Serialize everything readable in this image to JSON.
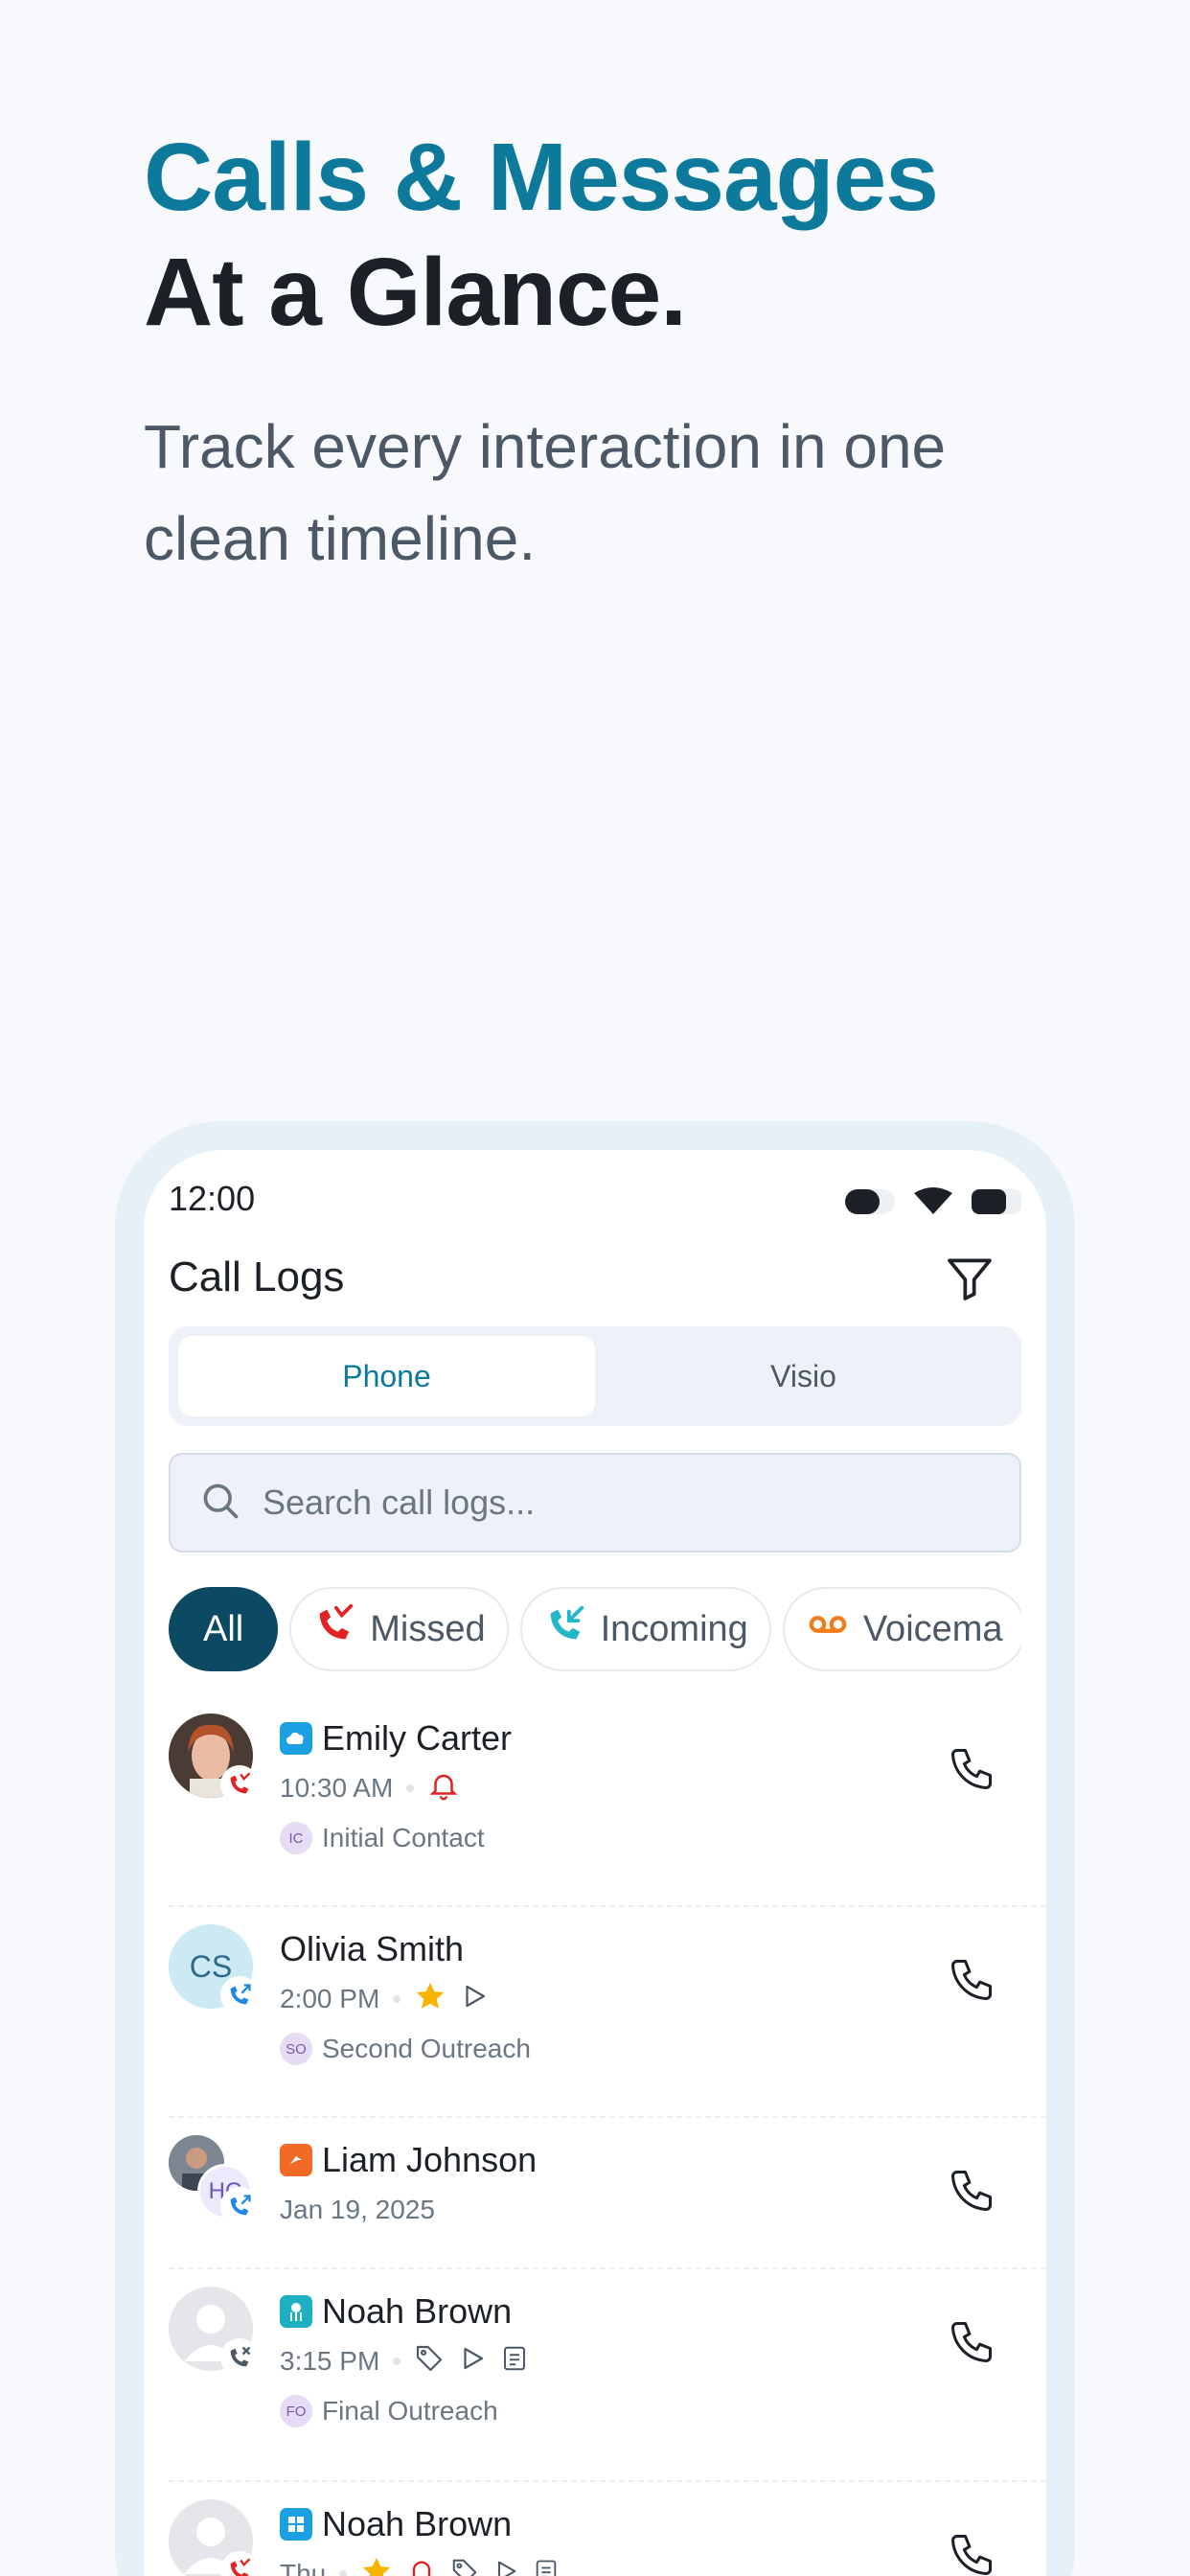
{
  "hero": {
    "title_line1": "Calls & Messages",
    "title_line2": "At a Glance.",
    "subtitle": "Track every interaction in one clean timeline."
  },
  "status_bar": {
    "time": "12:00"
  },
  "header": {
    "title": "Call Logs",
    "filter_icon": "filter-icon"
  },
  "tabs": [
    {
      "label": "Phone",
      "active": true
    },
    {
      "label": "Visio",
      "active": false
    }
  ],
  "search": {
    "placeholder": "Search call logs..."
  },
  "chips": [
    {
      "label": "All",
      "active": true
    },
    {
      "label": "Missed",
      "icon": "missed-call-icon",
      "color": "#e02424"
    },
    {
      "label": "Incoming",
      "icon": "incoming-call-icon",
      "color": "#22b8c9"
    },
    {
      "label": "Voicema",
      "icon": "voicemail-icon",
      "color": "#f07c1a"
    }
  ],
  "calls": [
    {
      "name": "Emily Carter",
      "time": "10:30 AM",
      "tag_initials": "IC",
      "tag": "Initial Contact",
      "brand_color": "#1ba0e2",
      "status": "missed",
      "extras": [
        "bell-icon"
      ]
    },
    {
      "name": "Olivia Smith",
      "avatar_initials": "CS",
      "time": "2:00 PM",
      "tag_initials": "SO",
      "tag": "Second Outreach",
      "status": "incoming-outbound",
      "extras": [
        "star-icon",
        "play-icon"
      ]
    },
    {
      "name": "Liam Johnson",
      "avatar_initials": "HC",
      "time": "Jan 19, 2025",
      "brand_color": "#f06a25",
      "status": "outbound"
    },
    {
      "name": "Noah Brown",
      "time": "3:15 PM",
      "tag_initials": "FO",
      "tag": "Final Outreach",
      "brand_color": "#1cb0c2",
      "status": "declined",
      "extras": [
        "tag-icon",
        "play-icon",
        "note-icon"
      ]
    },
    {
      "name": "Noah Brown",
      "time": "Thu",
      "brand_color": "#1ba0e2",
      "status": "missed",
      "extras": [
        "star-icon",
        "bell-icon",
        "tag-icon",
        "play-icon",
        "note-icon"
      ]
    }
  ],
  "colors": {
    "accent": "#0d7a9c",
    "chip_active": "#0c4a63",
    "missed": "#e02424",
    "incoming": "#22b8c9",
    "voicemail": "#f07c1a",
    "star": "#f7b500"
  }
}
